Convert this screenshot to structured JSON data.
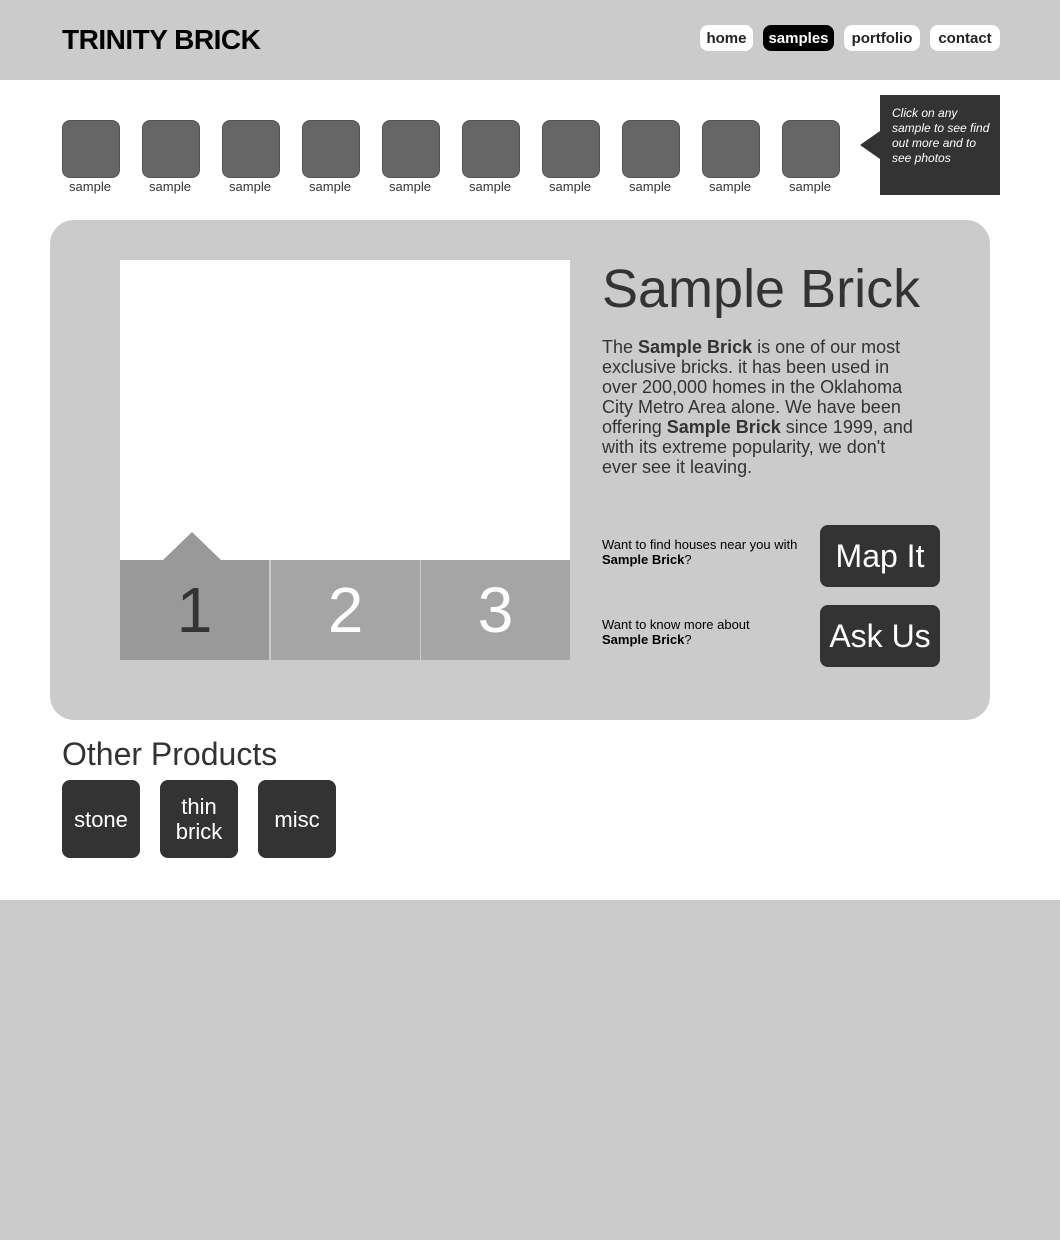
{
  "header": {
    "logo": "TRINITY BRICK",
    "nav": [
      {
        "label": "home",
        "active": false
      },
      {
        "label": "samples",
        "active": true
      },
      {
        "label": "portfolio",
        "active": false
      },
      {
        "label": "contact",
        "active": false
      }
    ]
  },
  "samples": {
    "items": [
      "sample",
      "sample",
      "sample",
      "sample",
      "sample",
      "sample",
      "sample",
      "sample",
      "sample",
      "sample"
    ],
    "tooltip": "Click on any sample to see find out more and to see photos"
  },
  "detail": {
    "title": "Sample Brick",
    "description_parts": [
      {
        "text": "The ",
        "bold": false
      },
      {
        "text": "Sample Brick",
        "bold": true
      },
      {
        "text": " is one of our most exclusive bricks.  it has been used in over 200,000 homes in the Oklahoma City Metro Area alone.  We have been offering ",
        "bold": false
      },
      {
        "text": "Sample Brick",
        "bold": true
      },
      {
        "text": " since 1999, and with its extreme popularity, we don't ever see it leaving.",
        "bold": false
      }
    ],
    "photo_tabs": [
      "1",
      "2",
      "3"
    ],
    "active_photo_tab": "1",
    "map_prompt_prefix": "Want to find houses near you with ",
    "map_prompt_bold": "Sample Brick",
    "map_prompt_suffix": "?",
    "map_button": "Map It",
    "ask_prompt_prefix": "Want to know more about ",
    "ask_prompt_bold": "Sample Brick",
    "ask_prompt_suffix": "?",
    "ask_button": "Ask Us"
  },
  "other_products": {
    "title": "Other Products",
    "items": [
      "stone",
      "thin brick",
      "misc"
    ]
  },
  "colors": {
    "background": "#cbcbcb",
    "dark": "#333333",
    "thumbnail": "#666666",
    "active_nav": "#000000"
  }
}
